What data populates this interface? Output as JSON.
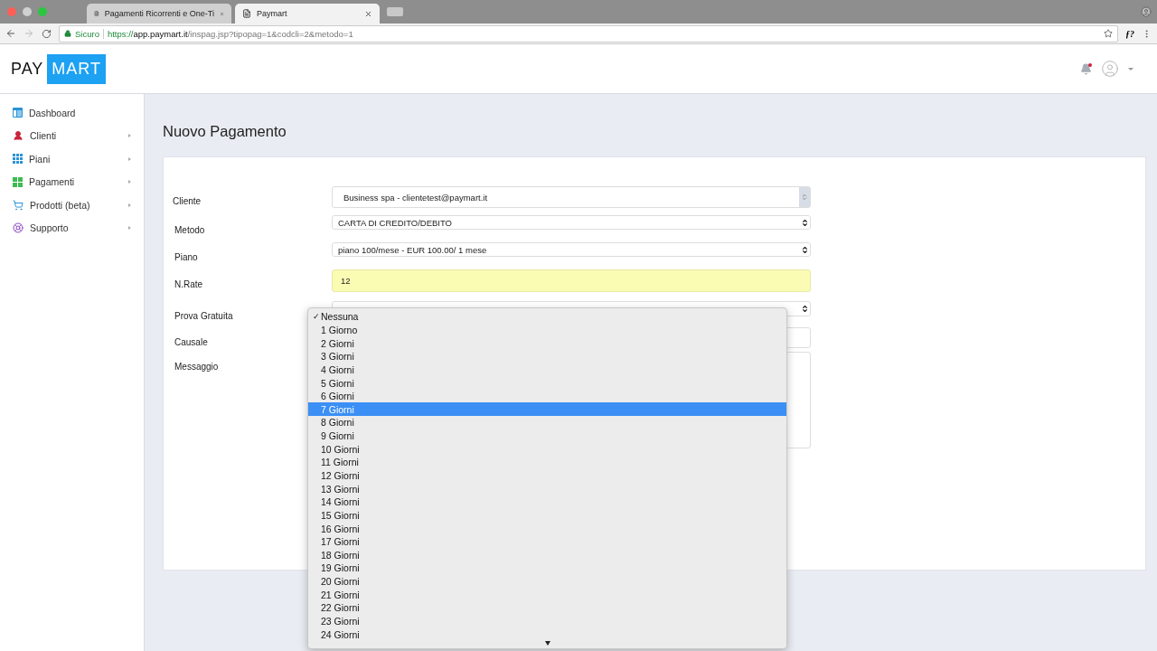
{
  "browser": {
    "tabs": [
      {
        "title": "Pagamenti Ricorrenti e One-Ti",
        "selected": false
      },
      {
        "title": "Paymart",
        "selected": true
      }
    ],
    "address": {
      "security": "Sicuro",
      "scheme": "https://",
      "host": "app.paymart.it",
      "path": "/inspag.jsp?tipopag=1&codcli=2&metodo=1"
    },
    "extension": "ƒ?"
  },
  "logo": {
    "left": "PAY",
    "right": "MART"
  },
  "header": {
    "notification": true
  },
  "sidebar": {
    "items": [
      {
        "label": "Dashboard",
        "submenu": false
      },
      {
        "label": "Clienti",
        "submenu": true
      },
      {
        "label": "Piani",
        "submenu": true
      },
      {
        "label": "Pagamenti",
        "submenu": true
      },
      {
        "label": "Prodotti (beta)",
        "submenu": true
      },
      {
        "label": "Supporto",
        "submenu": true
      }
    ]
  },
  "page": {
    "title": "Nuovo Pagamento"
  },
  "form": {
    "fields": [
      {
        "label": "Cliente",
        "kind": "combo",
        "value": "Business spa - clientetest@paymart.it"
      },
      {
        "label": "Metodo",
        "kind": "select",
        "value": "CARTA DI CREDITO/DEBITO"
      },
      {
        "label": "Piano",
        "kind": "select",
        "value": "piano 100/mese - EUR 100.00/ 1 mese"
      },
      {
        "label": "N.Rate",
        "kind": "autofill",
        "value": "12"
      },
      {
        "label": "Prova Gratuita",
        "kind": "select"
      },
      {
        "label": "Causale",
        "kind": "text"
      },
      {
        "label": "Messaggio",
        "kind": "textarea"
      }
    ]
  },
  "dropdown": {
    "check": "✓",
    "options": [
      {
        "label": "Nessuna",
        "selected": true,
        "highlighted": false
      },
      {
        "label": "1 Giorno",
        "selected": false,
        "highlighted": false
      },
      {
        "label": "2 Giorni",
        "selected": false,
        "highlighted": false
      },
      {
        "label": "3 Giorni",
        "selected": false,
        "highlighted": false
      },
      {
        "label": "4 Giorni",
        "selected": false,
        "highlighted": false
      },
      {
        "label": "5 Giorni",
        "selected": false,
        "highlighted": false
      },
      {
        "label": "6 Giorni",
        "selected": false,
        "highlighted": false
      },
      {
        "label": "7 Giorni",
        "selected": false,
        "highlighted": true
      },
      {
        "label": "8 Giorni",
        "selected": false,
        "highlighted": false
      },
      {
        "label": "9 Giorni",
        "selected": false,
        "highlighted": false
      },
      {
        "label": "10 Giorni",
        "selected": false,
        "highlighted": false
      },
      {
        "label": "11 Giorni",
        "selected": false,
        "highlighted": false
      },
      {
        "label": "12 Giorni",
        "selected": false,
        "highlighted": false
      },
      {
        "label": "13 Giorni",
        "selected": false,
        "highlighted": false
      },
      {
        "label": "14 Giorni",
        "selected": false,
        "highlighted": false
      },
      {
        "label": "15 Giorni",
        "selected": false,
        "highlighted": false
      },
      {
        "label": "16 Giorni",
        "selected": false,
        "highlighted": false
      },
      {
        "label": "17 Giorni",
        "selected": false,
        "highlighted": false
      },
      {
        "label": "18 Giorni",
        "selected": false,
        "highlighted": false
      },
      {
        "label": "19 Giorni",
        "selected": false,
        "highlighted": false
      },
      {
        "label": "20 Giorni",
        "selected": false,
        "highlighted": false
      },
      {
        "label": "21 Giorni",
        "selected": false,
        "highlighted": false
      },
      {
        "label": "22 Giorni",
        "selected": false,
        "highlighted": false
      },
      {
        "label": "23 Giorni",
        "selected": false,
        "highlighted": false
      },
      {
        "label": "24 Giorni",
        "selected": false,
        "highlighted": false
      }
    ]
  }
}
